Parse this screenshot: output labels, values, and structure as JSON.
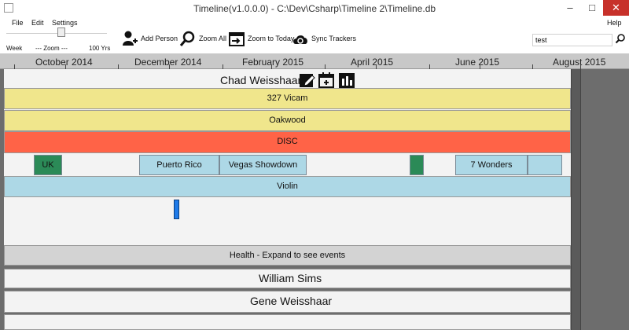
{
  "window": {
    "title": "Timeline(v1.0.0.0) - C:\\Dev\\Csharp\\Timeline 2\\Timeline.db",
    "minimize": "–",
    "maximize": "□",
    "close": "✕"
  },
  "menu": {
    "file": "File",
    "edit": "Edit",
    "settings": "Settings",
    "help": "Help"
  },
  "zoom": {
    "week_label": "Week",
    "center_label": "---  Zoom  ---",
    "max_label": "100 Yrs",
    "level": 0.55
  },
  "toolbar": {
    "add_person": "Add Person",
    "zoom_all": "Zoom All",
    "zoom_today": "Zoom to Today",
    "sync_trackers": "Sync Trackers"
  },
  "search": {
    "value": "test"
  },
  "axis": {
    "months": [
      "October 2014",
      "December 2014",
      "February 2015",
      "April 2015",
      "June 2015",
      "August 2015"
    ]
  },
  "people": {
    "chad": {
      "name": "Chad Weisshaar",
      "bands": {
        "vicam": "327 Vicam",
        "oakwood": "Oakwood",
        "disc": "DISC",
        "violin": "Violin",
        "health": "Health - Expand to see events"
      },
      "events": {
        "uk": "UK",
        "puerto_rico": "Puerto Rico",
        "vegas": "Vegas Showdown",
        "seven_wonders": "7 Wonders"
      }
    },
    "william": {
      "name": "William Sims"
    },
    "gene": {
      "name": "Gene Weisshaar"
    }
  },
  "colors": {
    "vicam": "#f0e68c",
    "oakwood": "#f0e68c",
    "disc": "#ff6347",
    "violin": "#add8e6",
    "health": "#d3d3d3",
    "event_green": "#2b8a57",
    "event_blue": "#add8e6",
    "marker": "#1e7ae8"
  }
}
